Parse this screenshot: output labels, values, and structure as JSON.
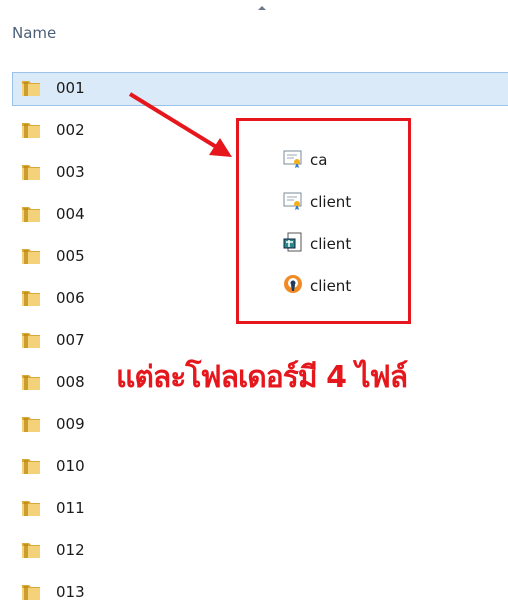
{
  "header": {
    "name_label": "Name"
  },
  "folders": [
    "001",
    "002",
    "003",
    "004",
    "005",
    "006",
    "007",
    "008",
    "009",
    "010",
    "011",
    "012",
    "013"
  ],
  "selected_folder": "001",
  "callout_files": [
    {
      "label": "ca",
      "icon": "certificate-icon"
    },
    {
      "label": "client",
      "icon": "certificate-icon"
    },
    {
      "label": "client",
      "icon": "key-file-icon"
    },
    {
      "label": "client",
      "icon": "openvpn-icon"
    }
  ],
  "annotation": "แต่ละโฟลเดอร์มี 4 ไฟล์",
  "colors": {
    "accent": "#e5161c",
    "selection": "#dbeaf8",
    "folder": "#e8c25a"
  }
}
